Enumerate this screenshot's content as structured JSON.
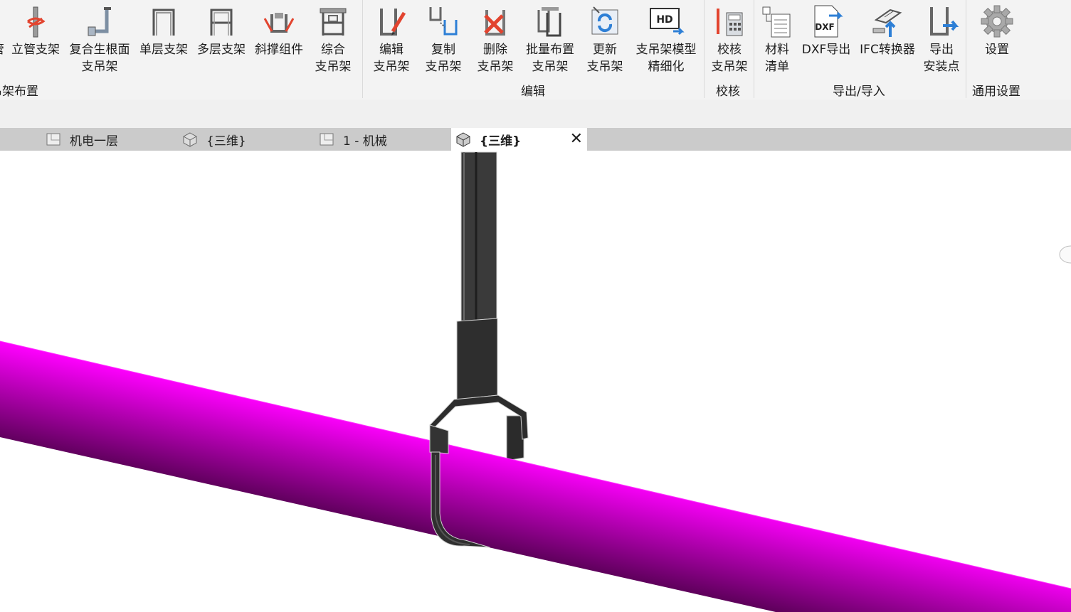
{
  "ribbon": {
    "tools": [
      {
        "id": "pipe-partial",
        "label": "管"
      },
      {
        "id": "vertical-pipe-support",
        "label": "立管支架"
      },
      {
        "id": "composite-root-support",
        "label": "复合生根面\n支吊架"
      },
      {
        "id": "single-layer-support",
        "label": "单层支架"
      },
      {
        "id": "multi-layer-support",
        "label": "多层支架"
      },
      {
        "id": "diagonal-brace-assembly",
        "label": "斜撑组件"
      },
      {
        "id": "integrated-support",
        "label": "综合\n支吊架"
      },
      {
        "id": "edit-support",
        "label": "编辑\n支吊架"
      },
      {
        "id": "copy-support",
        "label": "复制\n支吊架"
      },
      {
        "id": "delete-support",
        "label": "删除\n支吊架"
      },
      {
        "id": "batch-layout-support",
        "label": "批量布置\n支吊架"
      },
      {
        "id": "update-support",
        "label": "更新\n支吊架"
      },
      {
        "id": "support-model-refine",
        "label": "支吊架模型\n精细化"
      },
      {
        "id": "check-support",
        "label": "校核\n支吊架"
      },
      {
        "id": "material-list",
        "label": "材料\n清单"
      },
      {
        "id": "dxf-export",
        "label": "DXF导出"
      },
      {
        "id": "ifc-converter",
        "label": "IFC转换器"
      },
      {
        "id": "export-install-points",
        "label": "导出\n安装点"
      },
      {
        "id": "settings",
        "label": "设置"
      }
    ],
    "groups": [
      {
        "id": "layout",
        "label": "吊架布置"
      },
      {
        "id": "edit",
        "label": "编辑"
      },
      {
        "id": "check",
        "label": "校核"
      },
      {
        "id": "export-import",
        "label": "导出/导入"
      },
      {
        "id": "general-settings",
        "label": "通用设置"
      }
    ],
    "hd_badge": "HD",
    "dxf_badge": "DXF"
  },
  "tabs": [
    {
      "label": "机电一层",
      "icon": "floor-plan-icon",
      "active": false
    },
    {
      "label": "{三维}",
      "icon": "3d-view-icon",
      "active": false
    },
    {
      "label": "1 - 机械",
      "icon": "floor-plan-icon",
      "active": false
    },
    {
      "label": "{三维}",
      "icon": "3d-view-icon",
      "active": true
    }
  ],
  "close_glyph": "✕",
  "colors": {
    "pipe_light": "#ff00ff",
    "pipe_dark": "#5a0057",
    "hanger": "#2e2e2e",
    "accent_blue": "#2d7fd6",
    "accent_red": "#e2442f"
  }
}
